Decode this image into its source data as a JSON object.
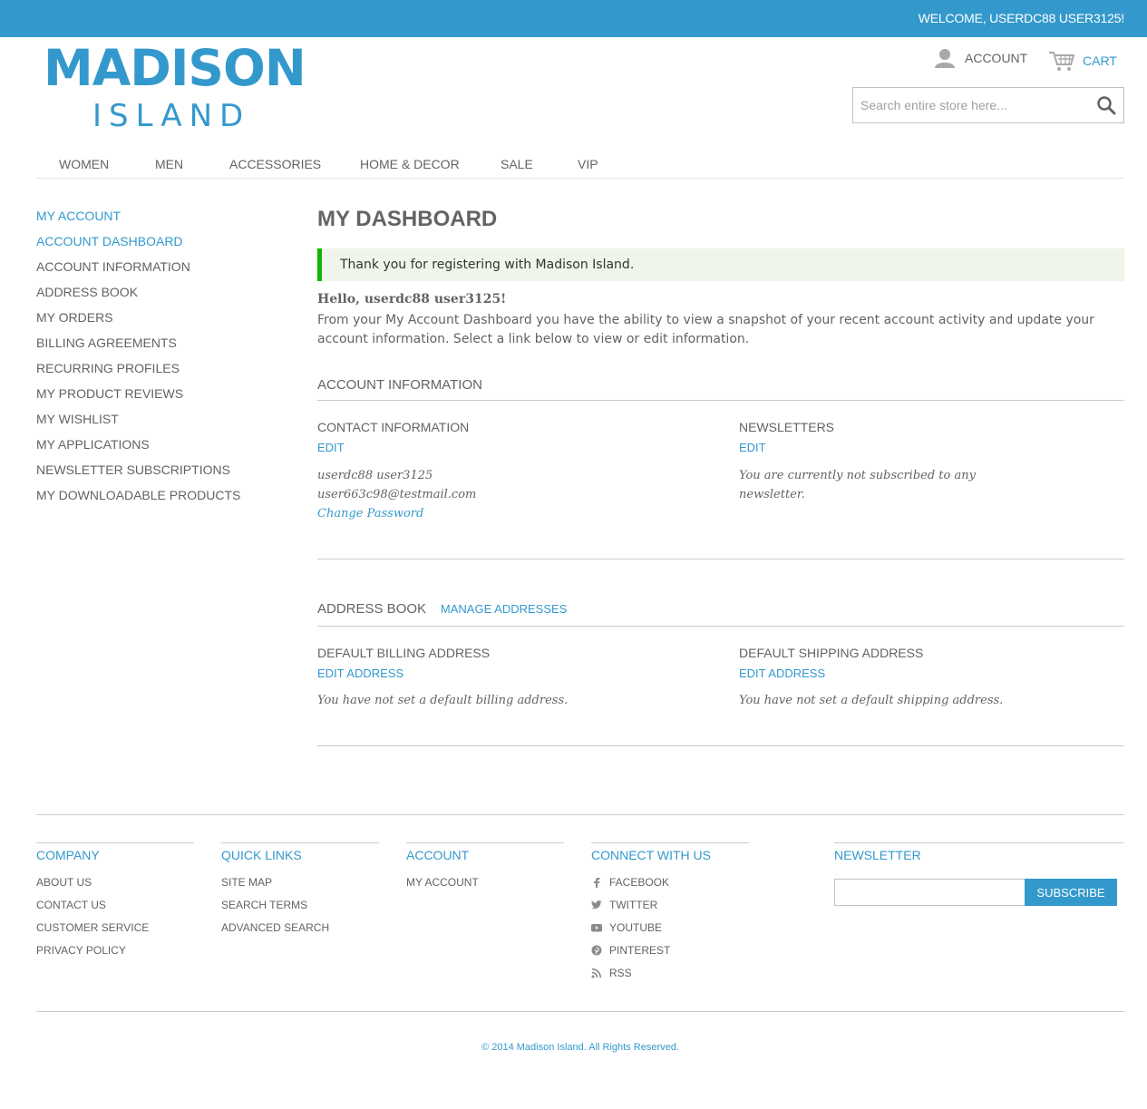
{
  "header": {
    "welcome": "WELCOME, USERDC88 USER3125!",
    "logo_main": "MADISON",
    "logo_sub": "ISLAND",
    "account_label": "ACCOUNT",
    "cart_label": "CART",
    "search_placeholder": "Search entire store here..."
  },
  "nav": {
    "items": [
      "WOMEN",
      "MEN",
      "ACCESSORIES",
      "HOME & DECOR",
      "SALE",
      "VIP"
    ]
  },
  "sidebar": {
    "title": "MY ACCOUNT",
    "items": [
      "ACCOUNT DASHBOARD",
      "ACCOUNT INFORMATION",
      "ADDRESS BOOK",
      "MY ORDERS",
      "BILLING AGREEMENTS",
      "RECURRING PROFILES",
      "MY PRODUCT REVIEWS",
      "MY WISHLIST",
      "MY APPLICATIONS",
      "NEWSLETTER SUBSCRIPTIONS",
      "MY DOWNLOADABLE PRODUCTS"
    ]
  },
  "main": {
    "title": "MY DASHBOARD",
    "success": "Thank you for registering with Madison Island.",
    "hello": "Hello, userdc88 user3125!",
    "intro": "From your My Account Dashboard you have the ability to view a snapshot of your recent account activity and update your account information. Select a link below to view or edit information.",
    "account_info": {
      "heading": "ACCOUNT INFORMATION",
      "contact_title": "CONTACT INFORMATION",
      "contact_edit": "EDIT",
      "name": "userdc88 user3125",
      "email": "user663c98@testmail.com",
      "change_password": "Change Password",
      "newsletters_title": "NEWSLETTERS",
      "newsletters_edit": "EDIT",
      "newsletters_text": "You are currently not subscribed to any newsletter."
    },
    "address_book": {
      "heading": "ADDRESS BOOK",
      "manage": "MANAGE ADDRESSES",
      "billing_title": "DEFAULT BILLING ADDRESS",
      "billing_edit": "EDIT ADDRESS",
      "billing_text": "You have not set a default billing address.",
      "shipping_title": "DEFAULT SHIPPING ADDRESS",
      "shipping_edit": "EDIT ADDRESS",
      "shipping_text": "You have not set a default shipping address."
    }
  },
  "footer": {
    "company": {
      "title": "COMPANY",
      "links": [
        "ABOUT US",
        "CONTACT US",
        "CUSTOMER SERVICE",
        "PRIVACY POLICY"
      ]
    },
    "quick_links": {
      "title": "QUICK LINKS",
      "links": [
        "SITE MAP",
        "SEARCH TERMS",
        "ADVANCED SEARCH"
      ]
    },
    "account": {
      "title": "ACCOUNT",
      "links": [
        "MY ACCOUNT"
      ]
    },
    "connect": {
      "title": "CONNECT WITH US",
      "links": [
        "FACEBOOK",
        "TWITTER",
        "YOUTUBE",
        "PINTEREST",
        "RSS"
      ]
    },
    "newsletter": {
      "title": "NEWSLETTER",
      "button": "SUBSCRIBE"
    },
    "copyright": "© 2014 Madison Island. All Rights Reserved."
  },
  "colors": {
    "accent": "#3399cc",
    "text": "#636363",
    "success_border": "#11b400",
    "success_bg": "#eff5ea"
  }
}
